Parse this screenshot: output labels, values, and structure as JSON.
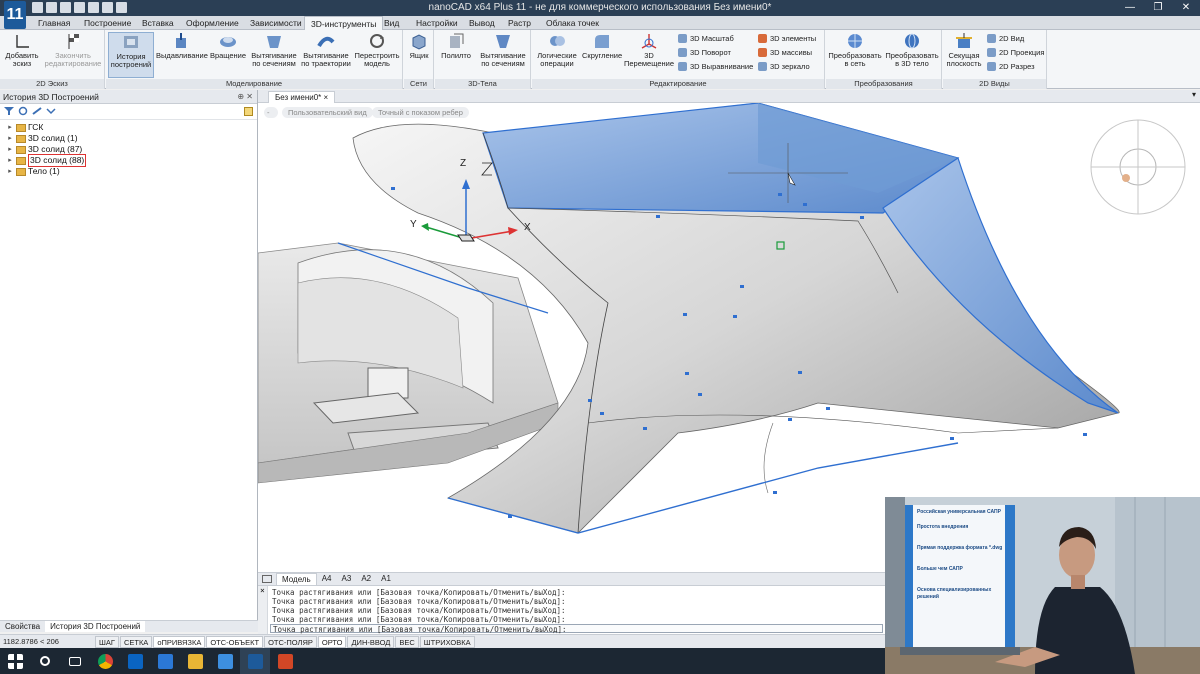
{
  "window": {
    "app_logo": "11",
    "title": "nanoCAD x64 Plus 11 - не для коммерческого использования Без имени0*",
    "controls": [
      "—",
      "❐",
      "✕"
    ]
  },
  "menu": {
    "tabs": [
      "Главная",
      "Построение",
      "Вставка",
      "Оформление",
      "Зависимости",
      "3D-инструменты",
      "Вид",
      "Настройки",
      "Вывод",
      "Растр",
      "Облака точек"
    ],
    "active": "3D-инструменты"
  },
  "ribbon": {
    "groups": [
      {
        "title": "2D Эскиз",
        "buttons": [
          "Добавить эскиз",
          "Закончить редактирование"
        ]
      },
      {
        "title": "Моделирование",
        "buttons": [
          "История построений",
          "Выдавливание",
          "Вращение",
          "Вытягивание по сечениям",
          "Вытягивание по траектории",
          "Перестроить модель"
        ]
      },
      {
        "title": "Сети",
        "buttons": [
          "Ящик"
        ]
      },
      {
        "title": "3D-Тела",
        "buttons": [
          "Полилто",
          "Вытягивание по сечениям"
        ]
      },
      {
        "title": "Редактирование",
        "buttons": [
          "Логические операции",
          "Скругление",
          "3D Перемещение"
        ],
        "small": [
          "3D Масштаб",
          "3D Поворот",
          "3D Выравнивание",
          "3D элементы",
          "3D массивы",
          "3D зеркало"
        ]
      },
      {
        "title": "Преобразования",
        "buttons": [
          "Преобразовать в сеть",
          "Преобразовать в 3D тело"
        ]
      },
      {
        "title": "2D Виды",
        "buttons": [
          "Секущая плоскость"
        ],
        "small": [
          "2D Вид",
          "2D Проекция",
          "2D Разрез"
        ]
      }
    ]
  },
  "left_panel": {
    "title": "История 3D Построений",
    "tree": [
      {
        "label": "ГСК",
        "selected": false
      },
      {
        "label": "3D солид (1)",
        "selected": false
      },
      {
        "label": "3D солид (87)",
        "selected": false
      },
      {
        "label": "3D солид (88)",
        "selected": true
      },
      {
        "label": "Тело (1)",
        "selected": false
      }
    ],
    "bottom_tabs": [
      "Свойства",
      "История 3D Построений"
    ]
  },
  "document": {
    "tab": "Без имени0*",
    "view_labels": [
      "Пользовательский вид",
      "Точный с показом ребер"
    ],
    "axes": {
      "x": "X",
      "y": "Y",
      "z": "Z"
    }
  },
  "layout_tabs": [
    "Модель",
    "A4",
    "A3",
    "A2",
    "A1"
  ],
  "command_lines": [
    "Точка растягивания или [Базовая точка/Копировать/Отменить/выХод]:",
    "Точка растягивания или [Базовая точка/Копировать/Отменить/выХод]:",
    "Точка растягивания или [Базовая точка/Копировать/Отменить/выХод]:",
    "Точка растягивания или [Базовая точка/Копировать/Отменить/выХод]:",
    "Точка растягивания или [Базовая точка/Копировать/Отменить/выХод]:"
  ],
  "command_gutter": "×",
  "status": {
    "coords": "1182.8786 < 206",
    "toggles": [
      "ШАГ",
      "СЕТКА",
      "оПРИВЯЗКА",
      "ОТС-ОБЪЕКТ",
      "ОТС-ПОЛЯР",
      "ОРТО",
      "ДИН-ВВОД",
      "ВЕС",
      "ШТРИХОВКА"
    ]
  },
  "webcam": {
    "board_lines": [
      "Российская универсальная САПР",
      "Простота внедрения",
      "Прямая поддержка формата *.dwg",
      "Больше чем САПР",
      "Основа специализированных решений"
    ]
  },
  "colors": {
    "title_bg": "#2b3f55",
    "surface_blue": "#6f9bd4",
    "edge_blue": "#2f6fd0"
  }
}
